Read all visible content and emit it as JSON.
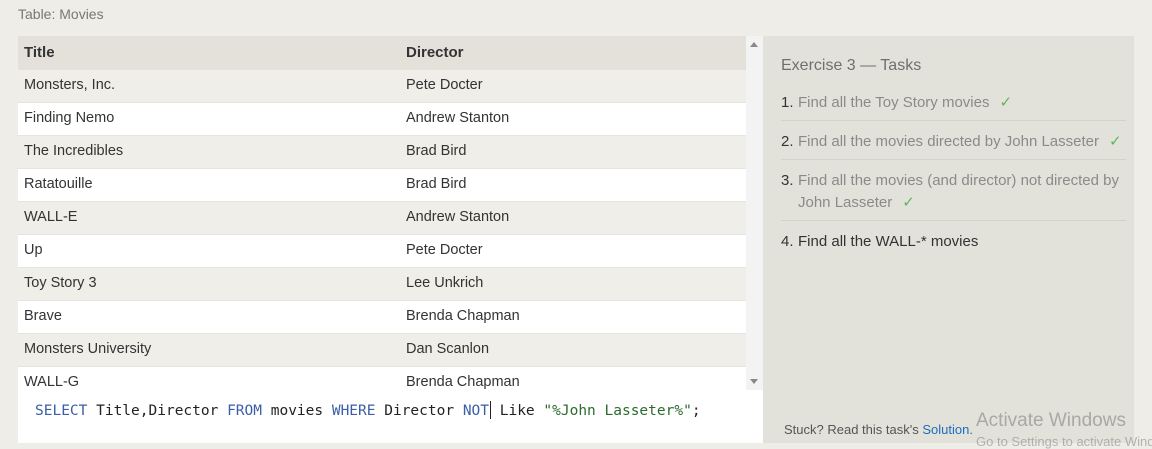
{
  "table": {
    "title": "Table: Movies",
    "columns": [
      "Title",
      "Director"
    ],
    "rows": [
      [
        "Monsters, Inc.",
        "Pete Docter"
      ],
      [
        "Finding Nemo",
        "Andrew Stanton"
      ],
      [
        "The Incredibles",
        "Brad Bird"
      ],
      [
        "Ratatouille",
        "Brad Bird"
      ],
      [
        "WALL-E",
        "Andrew Stanton"
      ],
      [
        "Up",
        "Pete Docter"
      ],
      [
        "Toy Story 3",
        "Lee Unkrich"
      ],
      [
        "Brave",
        "Brenda Chapman"
      ],
      [
        "Monsters University",
        "Dan Scanlon"
      ],
      [
        "WALL-G",
        "Brenda Chapman"
      ]
    ]
  },
  "editor": {
    "query_tokens": [
      {
        "text": "SELECT",
        "kind": "kw"
      },
      {
        "text": " Title,Director ",
        "kind": "plain"
      },
      {
        "text": "FROM",
        "kind": "kw"
      },
      {
        "text": " movies ",
        "kind": "plain"
      },
      {
        "text": "WHERE",
        "kind": "kw"
      },
      {
        "text": " Director ",
        "kind": "plain"
      },
      {
        "text": "NOT",
        "kind": "kw"
      },
      {
        "text": "CARET",
        "kind": "caret"
      },
      {
        "text": " Like ",
        "kind": "plain"
      },
      {
        "text": "\"%John Lasseter%\"",
        "kind": "str"
      },
      {
        "text": ";",
        "kind": "plain"
      }
    ]
  },
  "tasks": {
    "title": "Exercise 3 — Tasks",
    "items": [
      {
        "num": "1.",
        "text": "Find all the Toy Story movies",
        "done": true
      },
      {
        "num": "2.",
        "text": "Find all the movies directed by John Lasseter",
        "done": true
      },
      {
        "num": "3.",
        "text": "Find all the movies (and director) not directed by John Lasseter",
        "done": true
      },
      {
        "num": "4.",
        "text": "Find all the WALL-* movies",
        "done": false
      }
    ],
    "check_glyph": "✓",
    "stuck_text": "Stuck? Read this task's",
    "solution_link": "Solution."
  },
  "watermark": {
    "line1": "Activate Windows",
    "line2": "Go to Settings to activate Windows."
  },
  "colors": {
    "check": "#5cb85c",
    "keyword": "#3b5ea8",
    "string": "#2d6b2d",
    "link": "#1b6cbf"
  }
}
